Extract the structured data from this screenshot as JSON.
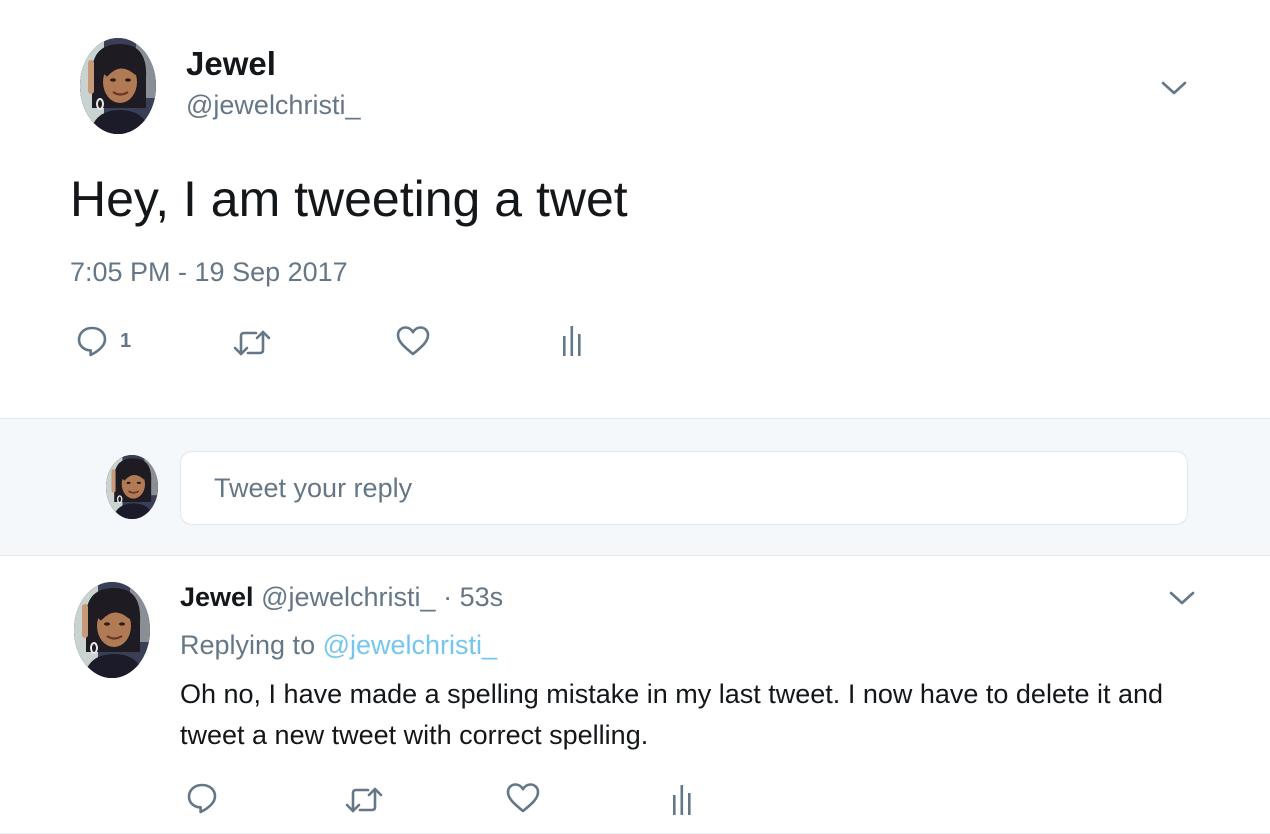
{
  "main_tweet": {
    "display_name": "Jewel",
    "handle": "@jewelchristi_",
    "text": "Hey, I am tweeting a twet",
    "timestamp": "7:05 PM - 19 Sep 2017",
    "reply_count": "1",
    "icons": [
      "reply-icon",
      "retweet-icon",
      "like-icon",
      "analytics-icon",
      "chevron-down-icon"
    ]
  },
  "composer": {
    "placeholder": "Tweet your reply"
  },
  "reply_tweet": {
    "display_name": "Jewel",
    "handle": "@jewelchristi_",
    "separator": "·",
    "age": "53s",
    "replying_prefix": "Replying to",
    "replying_to": "@jewelchristi_",
    "text": "Oh no, I have made a spelling mistake in my last tweet. I now have to delete it and tweet a new tweet with correct spelling."
  },
  "colors": {
    "text": "#14171a",
    "muted": "#657786",
    "link": "#74c6ef",
    "icon": "#657786",
    "composer_bg": "#f5f8fa",
    "border": "#e1e8ed"
  }
}
